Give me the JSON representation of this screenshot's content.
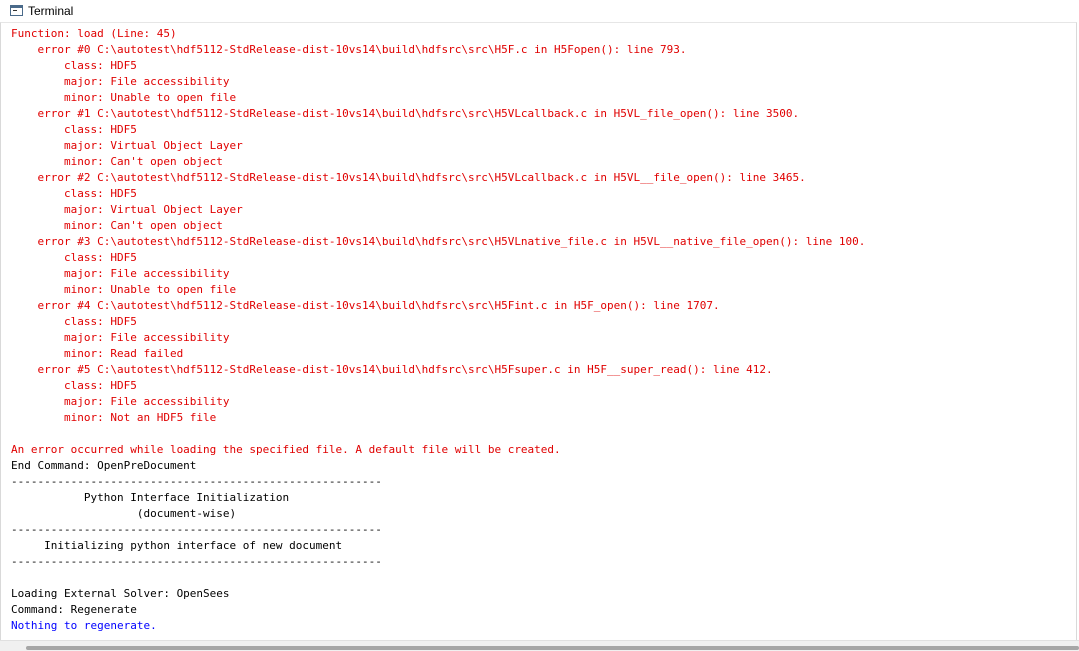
{
  "window": {
    "title": "Terminal",
    "icon": "terminal-icon"
  },
  "colors": {
    "error": "#e00000",
    "normal": "#000000",
    "info": "#0000ff"
  },
  "console": {
    "lines": [
      {
        "text": "Function: load (Line: 45)",
        "kind": "err"
      },
      {
        "text": "    error #0 C:\\autotest\\hdf5112-StdRelease-dist-10vs14\\build\\hdfsrc\\src\\H5F.c in H5Fopen(): line 793.",
        "kind": "err"
      },
      {
        "text": "        class: HDF5",
        "kind": "err"
      },
      {
        "text": "        major: File accessibility",
        "kind": "err"
      },
      {
        "text": "        minor: Unable to open file",
        "kind": "err"
      },
      {
        "text": "    error #1 C:\\autotest\\hdf5112-StdRelease-dist-10vs14\\build\\hdfsrc\\src\\H5VLcallback.c in H5VL_file_open(): line 3500.",
        "kind": "err"
      },
      {
        "text": "        class: HDF5",
        "kind": "err"
      },
      {
        "text": "        major: Virtual Object Layer",
        "kind": "err"
      },
      {
        "text": "        minor: Can't open object",
        "kind": "err"
      },
      {
        "text": "    error #2 C:\\autotest\\hdf5112-StdRelease-dist-10vs14\\build\\hdfsrc\\src\\H5VLcallback.c in H5VL__file_open(): line 3465.",
        "kind": "err"
      },
      {
        "text": "        class: HDF5",
        "kind": "err"
      },
      {
        "text": "        major: Virtual Object Layer",
        "kind": "err"
      },
      {
        "text": "        minor: Can't open object",
        "kind": "err"
      },
      {
        "text": "    error #3 C:\\autotest\\hdf5112-StdRelease-dist-10vs14\\build\\hdfsrc\\src\\H5VLnative_file.c in H5VL__native_file_open(): line 100.",
        "kind": "err"
      },
      {
        "text": "        class: HDF5",
        "kind": "err"
      },
      {
        "text": "        major: File accessibility",
        "kind": "err"
      },
      {
        "text": "        minor: Unable to open file",
        "kind": "err"
      },
      {
        "text": "    error #4 C:\\autotest\\hdf5112-StdRelease-dist-10vs14\\build\\hdfsrc\\src\\H5Fint.c in H5F_open(): line 1707.",
        "kind": "err"
      },
      {
        "text": "        class: HDF5",
        "kind": "err"
      },
      {
        "text": "        major: File accessibility",
        "kind": "err"
      },
      {
        "text": "        minor: Read failed",
        "kind": "err"
      },
      {
        "text": "    error #5 C:\\autotest\\hdf5112-StdRelease-dist-10vs14\\build\\hdfsrc\\src\\H5Fsuper.c in H5F__super_read(): line 412.",
        "kind": "err"
      },
      {
        "text": "        class: HDF5",
        "kind": "err"
      },
      {
        "text": "        major: File accessibility",
        "kind": "err"
      },
      {
        "text": "        minor: Not an HDF5 file",
        "kind": "err"
      },
      {
        "text": "",
        "kind": "normal"
      },
      {
        "text": "An error occurred while loading the specified file. A default file will be created.",
        "kind": "err"
      },
      {
        "text": "End Command: OpenPreDocument",
        "kind": "normal"
      },
      {
        "text": "--------------------------------------------------------",
        "kind": "normal"
      },
      {
        "text": "           Python Interface Initialization",
        "kind": "normal"
      },
      {
        "text": "                   (document-wise)",
        "kind": "normal"
      },
      {
        "text": "--------------------------------------------------------",
        "kind": "normal"
      },
      {
        "text": "     Initializing python interface of new document",
        "kind": "normal"
      },
      {
        "text": "--------------------------------------------------------",
        "kind": "normal"
      },
      {
        "text": "",
        "kind": "normal"
      },
      {
        "text": "Loading External Solver: OpenSees",
        "kind": "normal"
      },
      {
        "text": "Command: Regenerate",
        "kind": "normal"
      },
      {
        "text": "Nothing to regenerate.",
        "kind": "info"
      }
    ]
  }
}
